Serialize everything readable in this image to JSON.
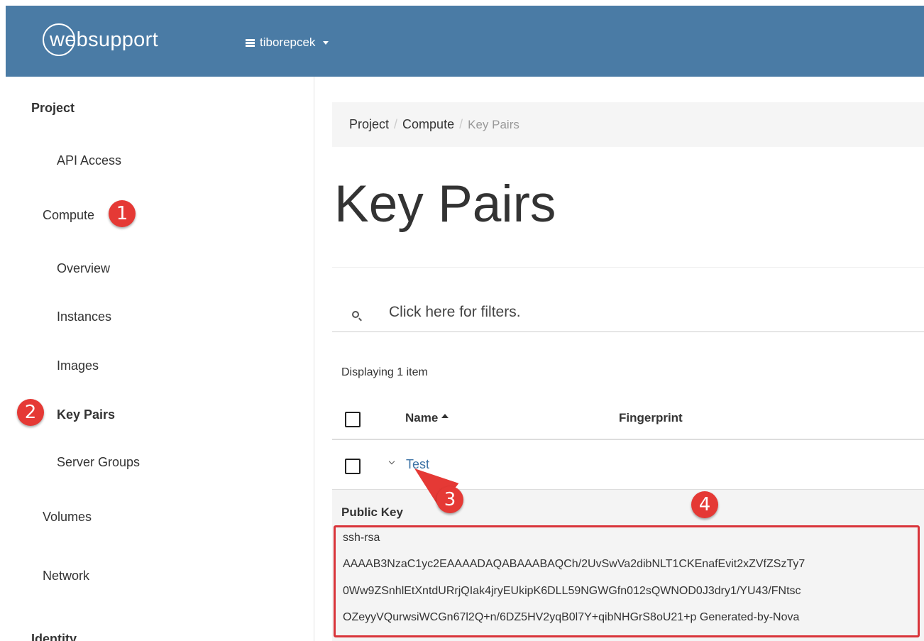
{
  "topbar": {
    "logo_text": "websupport",
    "project_switcher": "tiborepcek"
  },
  "sidebar": {
    "section_project": "Project",
    "api_access": "API Access",
    "compute": "Compute",
    "overview": "Overview",
    "instances": "Instances",
    "images": "Images",
    "key_pairs": "Key Pairs",
    "server_groups": "Server Groups",
    "volumes": "Volumes",
    "network": "Network",
    "identity": "Identity"
  },
  "breadcrumb": {
    "items": [
      "Project",
      "Compute",
      "Key Pairs"
    ],
    "separator": "/"
  },
  "page": {
    "title": "Key Pairs"
  },
  "filter": {
    "placeholder": "Click here for filters."
  },
  "table": {
    "count_text": "Displaying 1 item",
    "columns": [
      "Name",
      "Fingerprint"
    ],
    "rows": [
      {
        "name": "Test"
      }
    ],
    "detail": {
      "label": "Public Key",
      "key_lines": [
        "ssh-rsa",
        "AAAAB3NzaC1yc2EAAAADAQABAAABAQCh/2UvSwVa2dibNLT1CKEnafEvit2xZVfZSzTy7",
        "0Ww9ZSnhlEtXntdURrjQIak4jryEUkipK6DLL59NGWGfn012sQWNOD0J3dry1/YU43/FNtsc",
        "OZeyyVQurwsiWCGn67l2Q+n/6DZ5HV2yqB0l7Y+qibNHGrS8oU21+p Generated-by-Nova"
      ]
    }
  },
  "annotations": {
    "m1": "1",
    "m2": "2",
    "m3": "3",
    "m4": "4",
    "color": "#e53935"
  },
  "colors": {
    "topbar": "#4a7ba5",
    "link": "#3d73a6",
    "highlight_border": "#d9343a"
  }
}
